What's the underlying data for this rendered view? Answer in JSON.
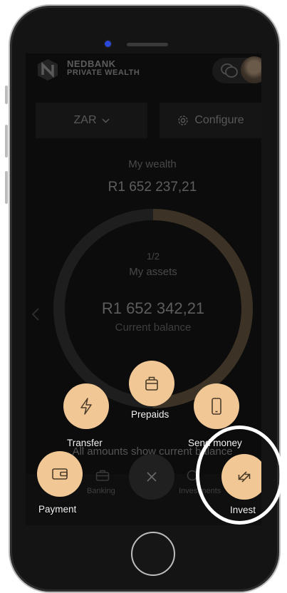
{
  "header": {
    "brand_line1": "NEDBANK",
    "brand_line2": "PRIVATE WEALTH"
  },
  "currency_selector": {
    "label": "ZAR"
  },
  "configure_button": {
    "label": "Configure"
  },
  "wealth": {
    "label": "My wealth",
    "value": "R1 652 237,21"
  },
  "assets_card": {
    "pager": "1/2",
    "title": "My assets",
    "value": "R1 652 342,21",
    "caption": "Current balance",
    "ring_fraction": 0.5
  },
  "note": "All amounts show current balance",
  "tabs": [
    {
      "label": "Banking",
      "icon": "briefcase-icon"
    },
    {
      "label": "Investments",
      "icon": "investments-icon"
    }
  ],
  "actions": {
    "prepaids": {
      "label": "Prepaids",
      "icon": "shopping-bag-icon"
    },
    "transfer": {
      "label": "Transfer",
      "icon": "lightning-icon"
    },
    "send_money": {
      "label": "Send money",
      "icon": "mobile-phone-icon"
    },
    "payment": {
      "label": "Payment",
      "icon": "wallet-icon"
    },
    "invest": {
      "label": "Invest",
      "icon": "swap-arrows-icon"
    },
    "close": {
      "icon": "close-icon"
    }
  },
  "colors": {
    "accent": "#f1c895",
    "ring_progress": "#3c3225",
    "ring_track": "#1e1e1e",
    "highlight": "#ffffff"
  }
}
